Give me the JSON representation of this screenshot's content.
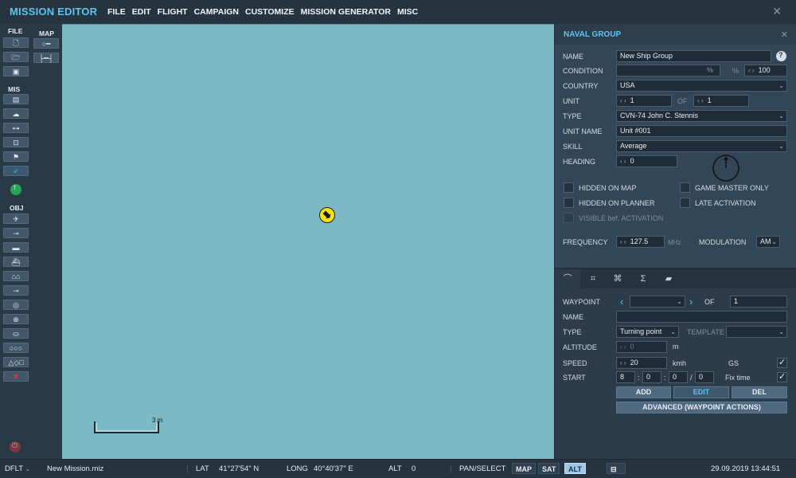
{
  "app": {
    "title": "MISSION EDITOR"
  },
  "menu": [
    "FILE",
    "EDIT",
    "FLIGHT",
    "CAMPAIGN",
    "CUSTOMIZE",
    "MISSION GENERATOR",
    "MISC"
  ],
  "toolbar": {
    "file_label": "FILE",
    "map_label": "MAP",
    "mis_label": "MIS",
    "obj_label": "OBJ"
  },
  "map": {
    "scale_label": "3 m",
    "background": "#7db9c4"
  },
  "panel": {
    "title": "NAVAL GROUP",
    "name_label": "NAME",
    "name_value": "New Ship Group",
    "condition_label": "CONDITION",
    "condition_unit": "%",
    "condition_pct_value": "%",
    "condition_value": "100",
    "country_label": "COUNTRY",
    "country_value": "USA",
    "unit_label": "UNIT",
    "unit_value": "1",
    "of_label": "OF",
    "unit_total": "1",
    "type_label": "TYPE",
    "type_value": "CVN-74 John C. Stennis",
    "unit_name_label": "UNIT NAME",
    "unit_name_value": "Unit #001",
    "skill_label": "SKILL",
    "skill_value": "Average",
    "heading_label": "HEADING",
    "heading_value": "0",
    "hidden_on_map": "HIDDEN ON MAP",
    "game_master_only": "GAME MASTER ONLY",
    "hidden_on_planner": "HIDDEN ON PLANNER",
    "late_activation": "LATE ACTIVATION",
    "visible_before_activation": "VISIBLE bef. ACTIVATION",
    "frequency_label": "FREQUENCY",
    "frequency_value": "127.5",
    "frequency_unit": "MHz",
    "modulation_label": "MODULATION",
    "modulation_value": "AM",
    "help": "?"
  },
  "waypoint": {
    "tabs": [
      "route-icon",
      "target-icon",
      "actions-icon",
      "summary-icon",
      "vehicle-icon"
    ],
    "waypoint_label": "WAYPOINT",
    "of_label": "OF",
    "waypoint_total": "1",
    "name_label": "NAME",
    "type_label": "TYPE",
    "type_value": "Turning point",
    "template_label": "TEMPLATE",
    "altitude_label": "ALTITUDE",
    "altitude_value": "0",
    "altitude_unit": "m",
    "speed_label": "SPEED",
    "speed_value": "20",
    "speed_unit": "kmh",
    "gs_label": "GS",
    "start_label": "START",
    "start_d": "8",
    "start_h": "0",
    "start_m": "0",
    "start_s": "0",
    "fix_time_label": "Fix time",
    "add_label": "ADD",
    "edit_label": "EDIT",
    "del_label": "DEL",
    "advanced_label": "ADVANCED (WAYPOINT ACTIONS)"
  },
  "status": {
    "profile": "DFLT",
    "file": "New Mission.miz",
    "lat_label": "LAT",
    "lat_value": "41°27'54\" N",
    "long_label": "LONG",
    "long_value": "40°40'37\" E",
    "alt_label": "ALT",
    "alt_value": "0",
    "pan_select": "PAN/SELECT",
    "map_btn": "MAP",
    "sat_btn": "SAT",
    "alt_btn": "ALT",
    "datetime": "29.09.2019 13:44:51"
  },
  "colors": {
    "accent": "#5fc4f0",
    "ship_icon": "#f6e218",
    "panel_bg": "#334657"
  }
}
